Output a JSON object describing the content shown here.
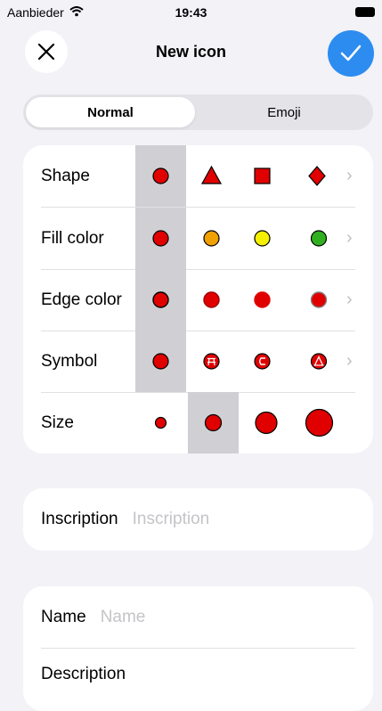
{
  "status_bar": {
    "carrier": "Aanbieder",
    "time": "19:43"
  },
  "nav": {
    "title": "New icon",
    "close_icon": "close-icon",
    "done_icon": "checkmark-icon"
  },
  "tabs": [
    {
      "label": "Normal",
      "selected": true
    },
    {
      "label": "Emoji",
      "selected": false
    }
  ],
  "icon_settings": {
    "shape": {
      "label": "Shape",
      "options": [
        "circle",
        "triangle",
        "square",
        "diamond"
      ],
      "selected": 0
    },
    "fill_color": {
      "label": "Fill color",
      "options": [
        "#e00000",
        "#f0a000",
        "#f5f000",
        "#30b020"
      ],
      "selected": 0
    },
    "edge_color": {
      "label": "Edge color",
      "options": [
        "#000000",
        "#a00000",
        "#e00000",
        "#808080"
      ],
      "selected": 0
    },
    "symbol": {
      "label": "Symbol",
      "options": [
        "none",
        "picnic-table",
        "horseshoe",
        "camping-tent"
      ],
      "selected": 0
    },
    "size": {
      "label": "Size",
      "options": [
        "small",
        "medium",
        "large",
        "extra-large"
      ],
      "selected": 1
    },
    "colors": {
      "accent": "#2d8cf0",
      "selection_bg": "#cfcfd4",
      "icon_red": "#e00000"
    }
  },
  "inscription": {
    "label": "Inscription",
    "placeholder": "Inscription"
  },
  "details": {
    "name": {
      "label": "Name",
      "placeholder": "Name"
    },
    "description": {
      "label": "Description"
    }
  }
}
